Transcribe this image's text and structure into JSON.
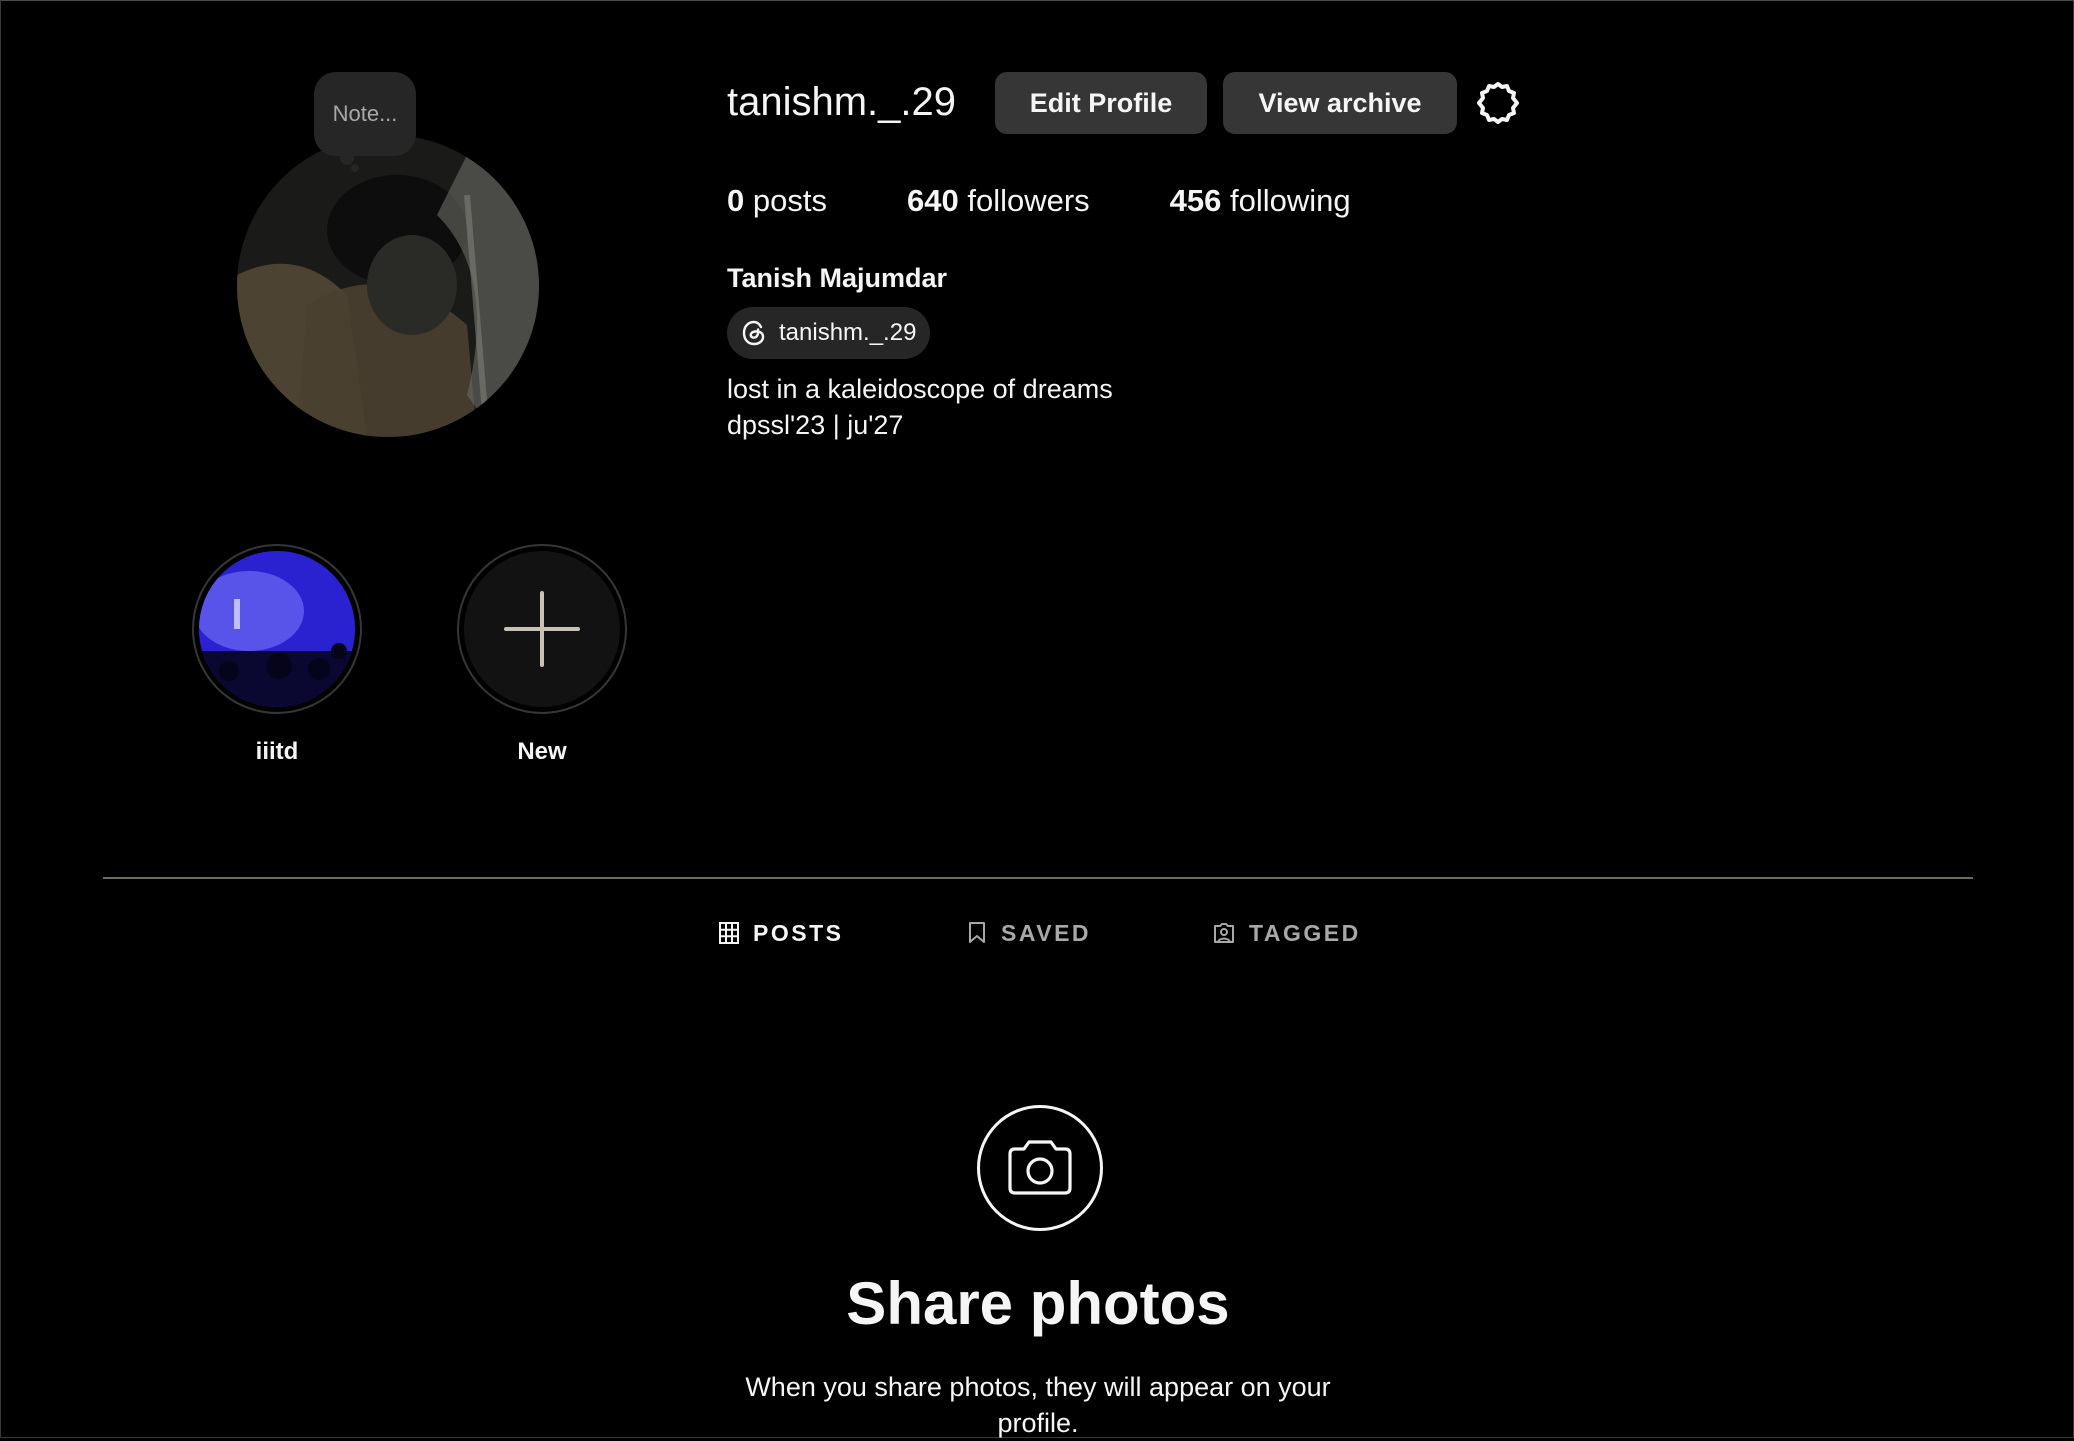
{
  "profile": {
    "username": "tanishm._.29",
    "full_name": "Tanish Majumdar",
    "note_placeholder": "Note...",
    "threads_handle": "tanishm._.29",
    "bio_lines": [
      "lost in a kaleidoscope of dreams",
      "dpssl'23 | ju'27"
    ]
  },
  "header": {
    "edit_profile_label": "Edit Profile",
    "view_archive_label": "View archive",
    "settings_icon": "gear-icon"
  },
  "stats": {
    "posts_count": "0",
    "posts_label": "posts",
    "followers_count": "640",
    "followers_label": "followers",
    "following_count": "456",
    "following_label": "following"
  },
  "highlights": [
    {
      "label": "iiitd"
    },
    {
      "label": "New"
    }
  ],
  "tabs": [
    {
      "label": "POSTS",
      "icon": "grid-icon",
      "active": true
    },
    {
      "label": "SAVED",
      "icon": "bookmark-icon",
      "active": false
    },
    {
      "label": "TAGGED",
      "icon": "tagged-user-icon",
      "active": false
    }
  ],
  "empty_state": {
    "icon": "camera-icon",
    "title": "Share photos",
    "description": "When you share photos, they will appear on your profile."
  },
  "colors": {
    "background": "#000000",
    "button_bg": "#363636",
    "pill_bg": "#262626",
    "text_primary": "#f5f5f5",
    "text_secondary": "#a8a8a8"
  }
}
